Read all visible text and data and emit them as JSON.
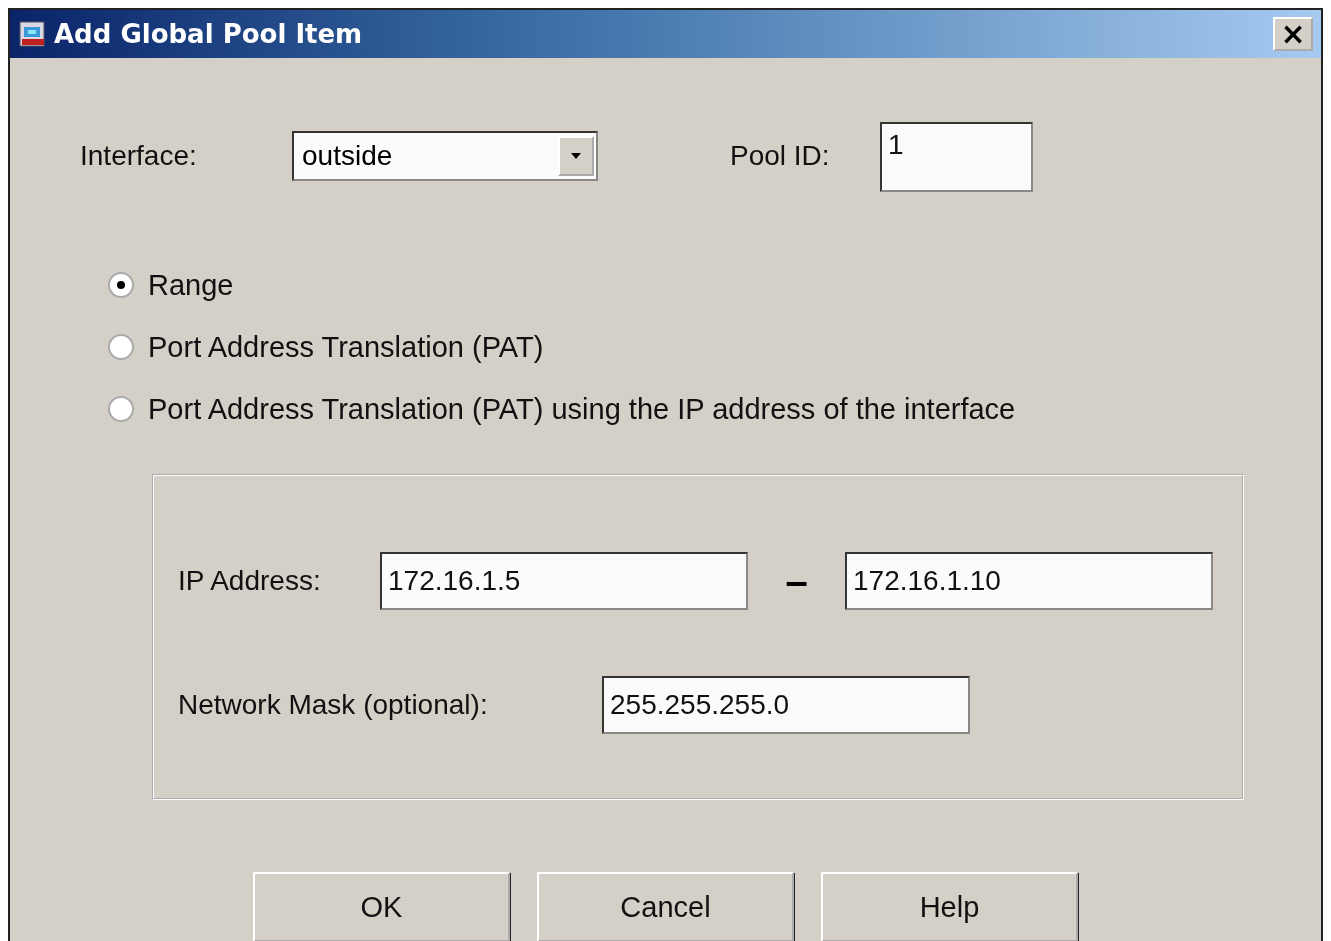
{
  "window": {
    "title": "Add Global Pool Item",
    "close": "×"
  },
  "interface": {
    "label": "Interface:",
    "value": "outside"
  },
  "pool_id": {
    "label": "Pool ID:",
    "value": "1"
  },
  "options": [
    {
      "label": "Range",
      "selected": true
    },
    {
      "label": "Port Address Translation (PAT)",
      "selected": false
    },
    {
      "label": "Port Address Translation (PAT) using the IP address of the interface",
      "selected": false
    }
  ],
  "ip_address": {
    "label": "IP Address:",
    "start": "172.16.1.5",
    "separator": "–",
    "end": "172.16.1.10"
  },
  "network_mask": {
    "label": "Network Mask (optional):",
    "value": "255.255.255.0"
  },
  "buttons": [
    "OK",
    "Cancel",
    "Help"
  ]
}
